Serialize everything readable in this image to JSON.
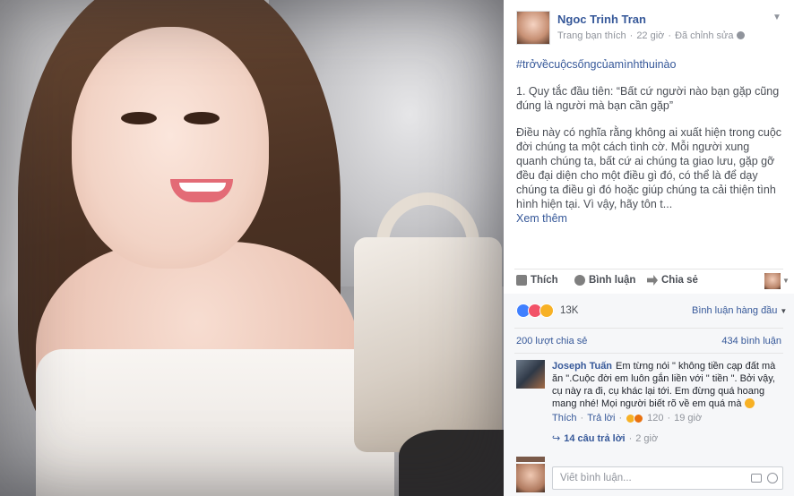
{
  "post": {
    "author": "Ngoc Trinh Tran",
    "audience": "Trang bạn thích",
    "time": "22 giờ",
    "edited": "Đã chỉnh sửa",
    "hashtag": "#trởvềcuộcsốngcủamìnhthuinào",
    "paragraph1": "1. Quy tắc đầu tiên: “Bất cứ người nào bạn gặp cũng đúng là người mà bạn cần gặp”",
    "paragraph2": "Điều này có nghĩa rằng không ai xuất hiện trong cuộc đời chúng ta một cách tình cờ. Mỗi người xung quanh chúng ta, bất cứ ai chúng ta giao lưu, gặp gỡ đều đại diện cho một điều gì đó, có thể là để dạy chúng ta điều gì đó hoặc giúp chúng ta cải thiện tình hình hiện tại. Vì vậy, hãy tôn t...",
    "see_more": "Xem thêm"
  },
  "actions": {
    "like": "Thích",
    "comment": "Bình luận",
    "share": "Chia sẻ"
  },
  "stats": {
    "reaction_count": "13K",
    "sort_label": "Bình luận hàng đầu",
    "shares": "200 lượt chia sẻ",
    "comments": "434 bình luận"
  },
  "comment": {
    "author": "Joseph Tuấn",
    "text": "Em từng nói \" không tiền cạp đất mà ăn \".Cuộc đời em luôn gắn liền với \" tiền \". Bởi vậy, cụ này ra đi, cụ khác lại tới. Em đừng quá hoang mang nhé! Mọi người biết rõ về em quá mà",
    "like": "Thích",
    "reply": "Trả lời",
    "reaction_count": "120",
    "time": "19 giờ"
  },
  "replies": {
    "label": "14 câu trả lời",
    "time": "2 giờ"
  },
  "composer": {
    "placeholder": "Viết bình luận..."
  },
  "icons": {
    "post_menu": "chevron-down-icon",
    "audience": "globe-icon",
    "reactions": [
      "like-reaction-icon",
      "love-reaction-icon",
      "haha-reaction-icon"
    ],
    "comment_reactions": [
      "haha-reaction-icon",
      "angry-reaction-icon"
    ],
    "composer": [
      "camera-icon",
      "sticker-icon"
    ]
  },
  "colors": {
    "link": "#365899",
    "meta": "#90949c",
    "like": "#4080ff",
    "love": "#f25268",
    "haha": "#f7b125",
    "angry": "#e9710f"
  }
}
